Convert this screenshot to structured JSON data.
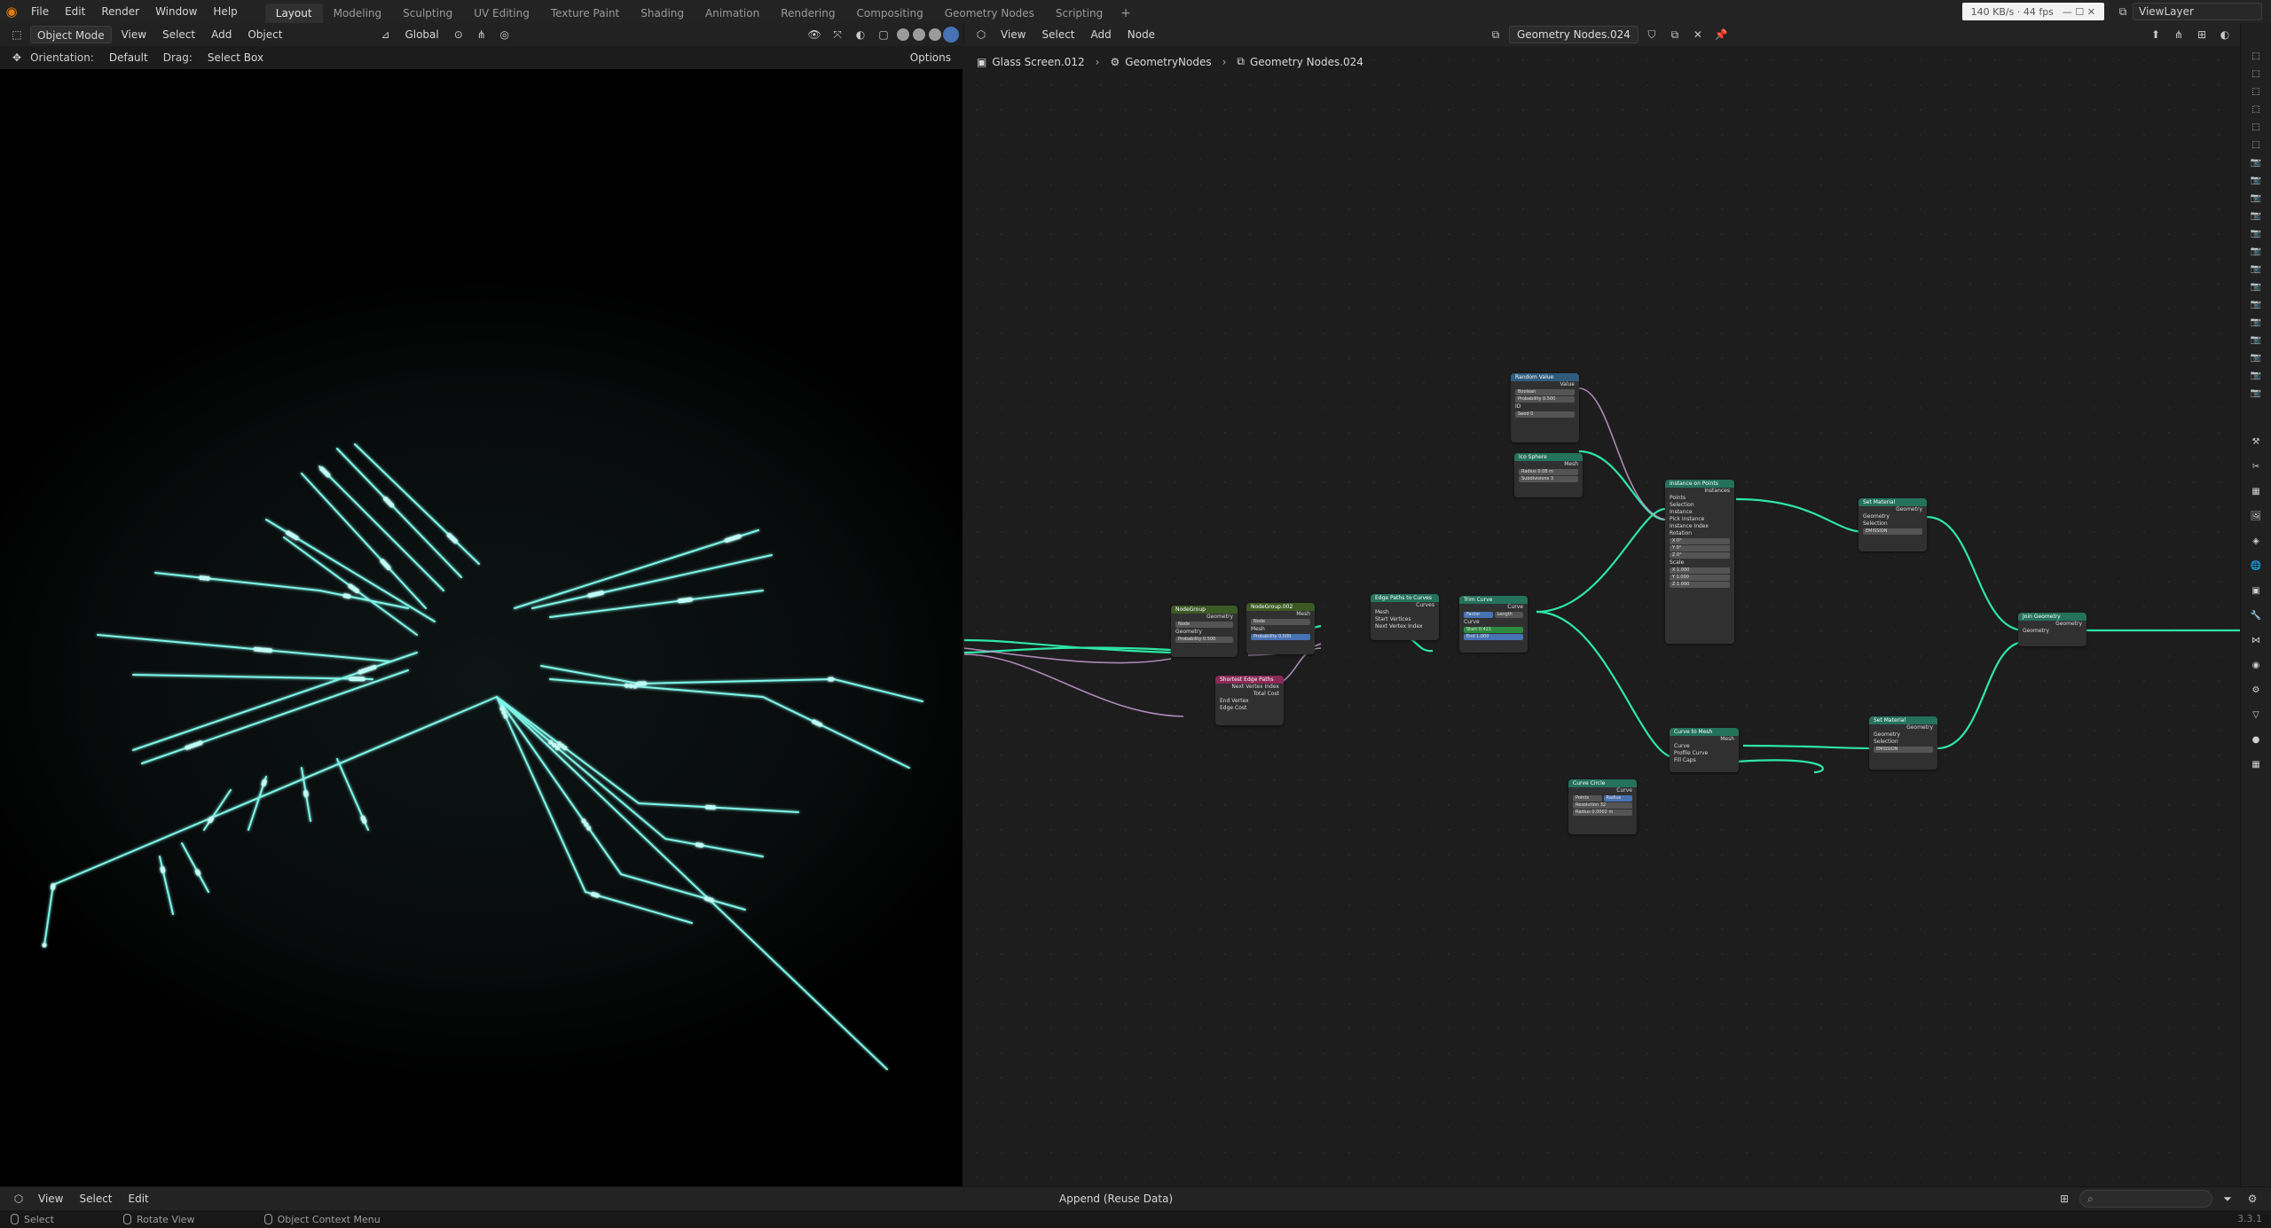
{
  "app": {
    "menu": [
      "File",
      "Edit",
      "Render",
      "Window",
      "Help"
    ],
    "workspaces": [
      "Layout",
      "Modeling",
      "Sculpting",
      "UV Editing",
      "Texture Paint",
      "Shading",
      "Animation",
      "Rendering",
      "Compositing",
      "Geometry Nodes",
      "Scripting"
    ],
    "active_workspace": "Layout",
    "net_speed": "140 KB/s · 44 fps",
    "view_layer": "ViewLayer",
    "accent": "#4772b3"
  },
  "viewport": {
    "mode": "Object Mode",
    "menus": [
      "View",
      "Select",
      "Add",
      "Object"
    ],
    "transform": "Global",
    "orientation_label": "Orientation:",
    "orientation_value": "Default",
    "drag_label": "Drag:",
    "drag_value": "Select Box",
    "options": "Options",
    "glow_color": "#7ff5e8"
  },
  "node_editor": {
    "menus": [
      "View",
      "Select",
      "Add",
      "Node"
    ],
    "tree_name": "Geometry Nodes.024",
    "breadcrumbs": [
      "Glass Screen.012",
      "GeometryNodes",
      "Geometry Nodes.024"
    ],
    "link_color": "#2ee6a6",
    "field_link_color": "#c49bd0",
    "nodes": {
      "random_value": {
        "title": "Random Value",
        "out": "Value",
        "type": "Boolean",
        "prob": "Probability",
        "prob_val": "0.500",
        "id": "ID",
        "seed": "Seed",
        "seed_val": "0"
      },
      "ico_sphere": {
        "title": "Ico Sphere",
        "out": "Mesh",
        "radius": "Radius",
        "radius_val": "0.08 m",
        "subdiv": "Subdivisions",
        "subdiv_val": "3"
      },
      "instance_on_points": {
        "title": "Instance on Points",
        "out": "Instances",
        "points": "Points",
        "selection": "Selection",
        "instance": "Instance",
        "pick": "Pick Instance",
        "index": "Instance Index",
        "rotation": "Rotation",
        "scale": "Scale",
        "x": "X",
        "y": "Y",
        "z": "Z",
        "rot_val": "0°",
        "scale_val": "1.000"
      },
      "set_material_1": {
        "title": "Set Material",
        "out": "Geometry",
        "geometry": "Geometry",
        "selection": "Selection",
        "material": "EMISSION"
      },
      "node_group_1": {
        "title": "NodeGroup",
        "out": "Geometry",
        "geometry": "Geometry",
        "sel": "Node",
        "prob": "Probability",
        "prob_val": "0.500"
      },
      "node_group_2": {
        "title": "NodeGroup.002",
        "out": "Mesh",
        "mesh": "Mesh",
        "sel": "Node",
        "prob": "Probability",
        "prob_val": "0.500"
      },
      "shortest_path": {
        "title": "Shortest Edge Paths",
        "next": "Next Vertex Index",
        "total": "Total Cost",
        "end": "End Vertex",
        "cost": "Edge Cost"
      },
      "edge_paths": {
        "title": "Edge Paths to Curves",
        "out": "Curves",
        "mesh": "Mesh",
        "start": "Start Vertices",
        "next": "Next Vertex Index"
      },
      "trim_curve": {
        "title": "Trim Curve",
        "out": "Curve",
        "mode_a": "Factor",
        "mode_b": "Length",
        "curve": "Curve",
        "start": "Start",
        "start_val": "0.421",
        "end": "End",
        "end_val": "1.000"
      },
      "curve_to_mesh": {
        "title": "Curve to Mesh",
        "out": "Mesh",
        "curve": "Curve",
        "profile": "Profile Curve",
        "fill": "Fill Caps"
      },
      "set_material_2": {
        "title": "Set Material",
        "out": "Geometry",
        "geometry": "Geometry",
        "selection": "Selection",
        "material": "EMISSION"
      },
      "curve_circle": {
        "title": "Curve Circle",
        "out": "Curve",
        "mode_a": "Points",
        "mode_b": "Radius",
        "res": "Resolution",
        "res_val": "32",
        "radius": "Radius",
        "radius_val": "0.0002 m"
      },
      "join_geometry": {
        "title": "Join Geometry",
        "out": "Geometry",
        "geometry": "Geometry"
      }
    }
  },
  "bottom": {
    "menus": [
      "View",
      "Select",
      "Edit"
    ],
    "mode": "Append (Reuse Data)",
    "search_placeholder": ""
  },
  "status": {
    "items": [
      "Select",
      "Rotate View",
      "Object Context Menu"
    ],
    "version": "3.3.1"
  }
}
